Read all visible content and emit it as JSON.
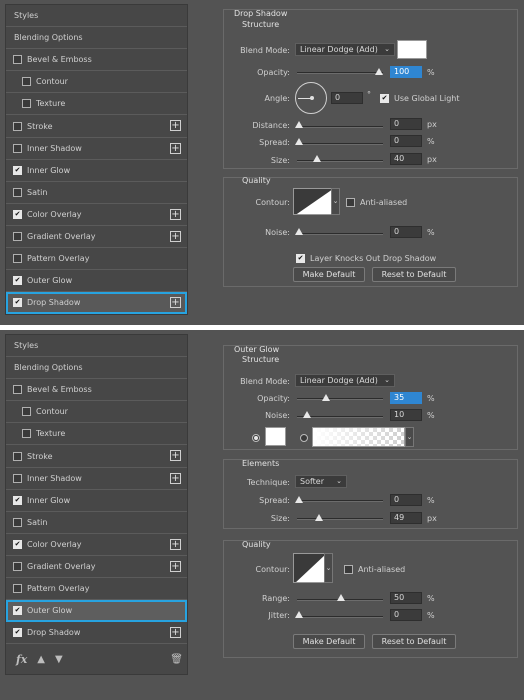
{
  "style_list_items": [
    {
      "label": "Styles",
      "type": "header"
    },
    {
      "label": "Blending Options",
      "type": "header"
    },
    {
      "label": "Bevel & Emboss",
      "checked": false,
      "plus": false
    },
    {
      "label": "Contour",
      "checked": false,
      "plus": false,
      "sub": true
    },
    {
      "label": "Texture",
      "checked": false,
      "plus": false,
      "sub": true
    },
    {
      "label": "Stroke",
      "checked": false,
      "plus": true
    },
    {
      "label": "Inner Shadow",
      "checked": false,
      "plus": true
    },
    {
      "label": "Inner Glow",
      "checked": true,
      "plus": false
    },
    {
      "label": "Satin",
      "checked": false,
      "plus": false
    },
    {
      "label": "Color Overlay",
      "checked": true,
      "plus": true
    },
    {
      "label": "Gradient Overlay",
      "checked": false,
      "plus": true
    },
    {
      "label": "Pattern Overlay",
      "checked": false,
      "plus": false
    },
    {
      "label": "Outer Glow",
      "checked": true,
      "plus": false
    },
    {
      "label": "Drop Shadow",
      "checked": true,
      "plus": true
    }
  ],
  "top": {
    "selected_item": "Drop Shadow",
    "title": "Drop Shadow",
    "structure_label": "Structure",
    "blend_mode_label": "Blend Mode:",
    "blend_mode_value": "Linear Dodge (Add)",
    "opacity_label": "Opacity:",
    "opacity_value": "100",
    "angle_label": "Angle:",
    "angle_value": "0",
    "use_global_light_label": "Use Global Light",
    "use_global_light_checked": true,
    "distance_label": "Distance:",
    "distance_value": "0",
    "spread_label": "Spread:",
    "spread_value": "0",
    "size_label": "Size:",
    "size_value": "40",
    "quality_label": "Quality",
    "contour_label": "Contour:",
    "anti_aliased_label": "Anti-aliased",
    "noise_label": "Noise:",
    "noise_value": "0",
    "layer_knocks_label": "Layer Knocks Out Drop Shadow",
    "make_default_label": "Make Default",
    "reset_default_label": "Reset to Default",
    "unit_percent": "%",
    "unit_px": "px",
    "unit_degree": "°"
  },
  "bottom": {
    "selected_item": "Outer Glow",
    "title": "Outer Glow",
    "structure_label": "Structure",
    "blend_mode_label": "Blend Mode:",
    "blend_mode_value": "Linear Dodge (Add)",
    "opacity_label": "Opacity:",
    "opacity_value": "35",
    "noise_label": "Noise:",
    "noise_value": "10",
    "elements_label": "Elements",
    "technique_label": "Technique:",
    "technique_value": "Softer",
    "spread_label": "Spread:",
    "spread_value": "0",
    "size_label": "Size:",
    "size_value": "49",
    "quality_label": "Quality",
    "contour_label": "Contour:",
    "anti_aliased_label": "Anti-aliased",
    "range_label": "Range:",
    "range_value": "50",
    "jitter_label": "Jitter:",
    "jitter_value": "0",
    "make_default_label": "Make Default",
    "reset_default_label": "Reset to Default",
    "unit_percent": "%",
    "unit_px": "px"
  },
  "footer": {
    "fx_label": "fx",
    "up_icon": "▲",
    "down_icon": "▼",
    "trash_icon": "🗑"
  },
  "icons": {
    "plus": "+",
    "check": "✔",
    "chevron": "⌄"
  },
  "colors": {
    "accent_blue": "#27a3e0",
    "panel": "#535353",
    "highlight": "#2f86d2"
  }
}
